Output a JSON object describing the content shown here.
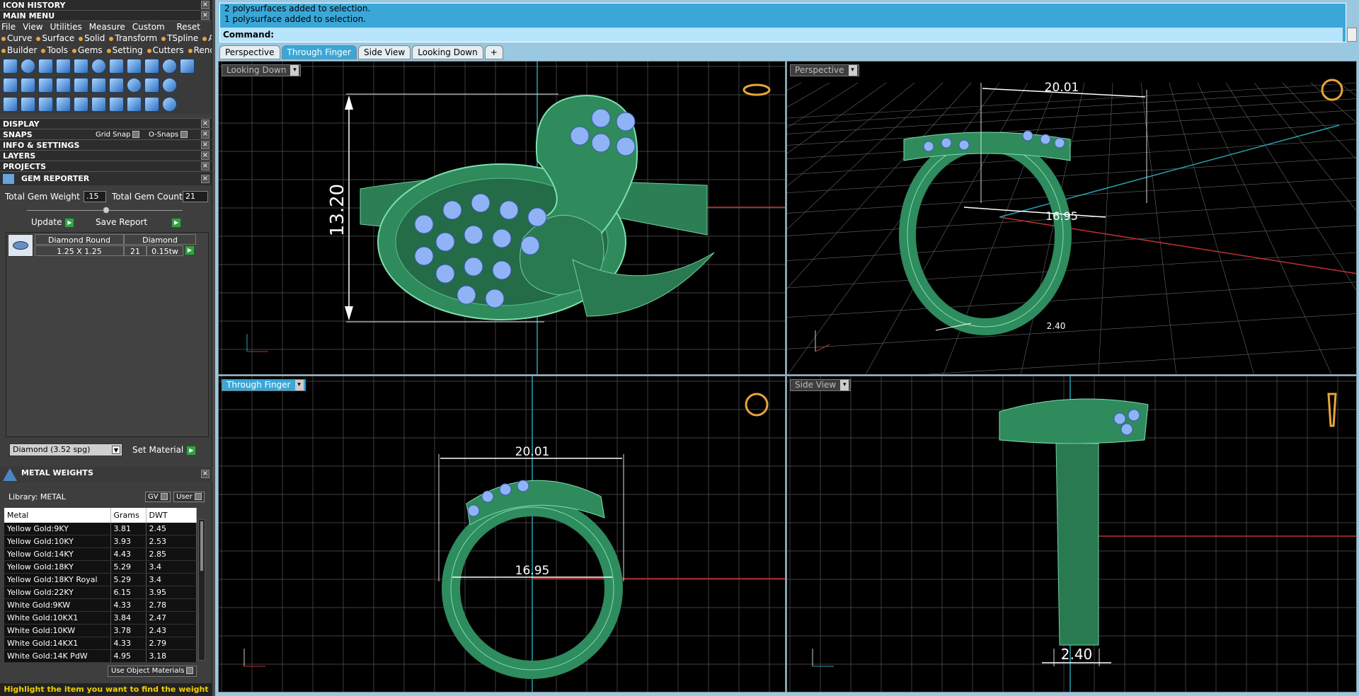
{
  "panels": {
    "icon_history": "ICON HISTORY",
    "main_menu": "MAIN MENU"
  },
  "menu": [
    "File",
    "View",
    "Utilities",
    "Measure",
    "Custom",
    "Reset"
  ],
  "tabs_row1": [
    "Curve",
    "Surface",
    "Solid",
    "Transform",
    "TSpline",
    "Art"
  ],
  "tabs_row2": [
    "Builder",
    "Tools",
    "Gems",
    "Setting",
    "Cutters",
    "Render"
  ],
  "sections": {
    "display": "DISPLAY",
    "snaps": "SNAPS",
    "grid_snap": "Grid Snap",
    "o_snaps": "O-Snaps",
    "info": "INFO & SETTINGS",
    "layers": "LAYERS",
    "projects": "PROJECTS"
  },
  "gem_reporter": {
    "title": "GEM REPORTER",
    "weight_label": "Total Gem Weight",
    "weight_value": ".15",
    "count_label": "Total Gem Count",
    "count_value": "21",
    "update": "Update",
    "save_report": "Save Report",
    "gem": {
      "shape": "Diamond Round",
      "type": "Diamond",
      "size": "1.25 X 1.25",
      "count": "21",
      "weight": "0.15tw"
    },
    "material_select": "Diamond    (3.52 spg)",
    "set_material": "Set Material"
  },
  "metal_weights": {
    "title": "METAL WEIGHTS",
    "library": "Library: METAL",
    "gv": "GV",
    "user": "User",
    "columns": [
      "Metal",
      "Grams",
      "DWT"
    ],
    "rows": [
      [
        "Yellow Gold:9KY",
        "3.81",
        "2.45"
      ],
      [
        "Yellow Gold:10KY",
        "3.93",
        "2.53"
      ],
      [
        "Yellow Gold:14KY",
        "4.43",
        "2.85"
      ],
      [
        "Yellow Gold:18KY",
        "5.29",
        "3.4"
      ],
      [
        "Yellow Gold:18KY Royal",
        "5.29",
        "3.4"
      ],
      [
        "Yellow Gold:22KY",
        "6.15",
        "3.95"
      ],
      [
        "White Gold:9KW",
        "4.33",
        "2.78"
      ],
      [
        "White Gold:10KX1",
        "3.84",
        "2.47"
      ],
      [
        "White Gold:10KW",
        "3.78",
        "2.43"
      ],
      [
        "White Gold:14KX1",
        "4.33",
        "2.79"
      ],
      [
        "White Gold:14K PdW",
        "4.95",
        "3.18"
      ]
    ],
    "use_object_materials": "Use Object Materials"
  },
  "status": "Highlight the item you want to find the weight",
  "command": {
    "line1": "2 polysurfaces added to selection.",
    "line2": "1 polysurface added to selection.",
    "prompt": "Command:"
  },
  "view_tabs": [
    "Perspective",
    "Through Finger",
    "Side View",
    "Looking Down",
    "+"
  ],
  "viewports": {
    "top_left": {
      "label": "Looking Down",
      "dim": "13.20"
    },
    "top_right": {
      "label": "Perspective",
      "dim1": "20.01",
      "dim2": "16.95",
      "dim3": "2.40"
    },
    "bottom_left": {
      "label": "Through Finger",
      "dim1": "20.01",
      "dim2": "16.95"
    },
    "bottom_right": {
      "label": "Side View",
      "dim": "2.40"
    }
  },
  "colors": {
    "accent": "#3aa7d8",
    "metal": "#2e8c5e",
    "gem": "#8fb3f5",
    "grid": "#555555",
    "axis_x": "#c03030",
    "axis_y": "#2aa0b0"
  }
}
